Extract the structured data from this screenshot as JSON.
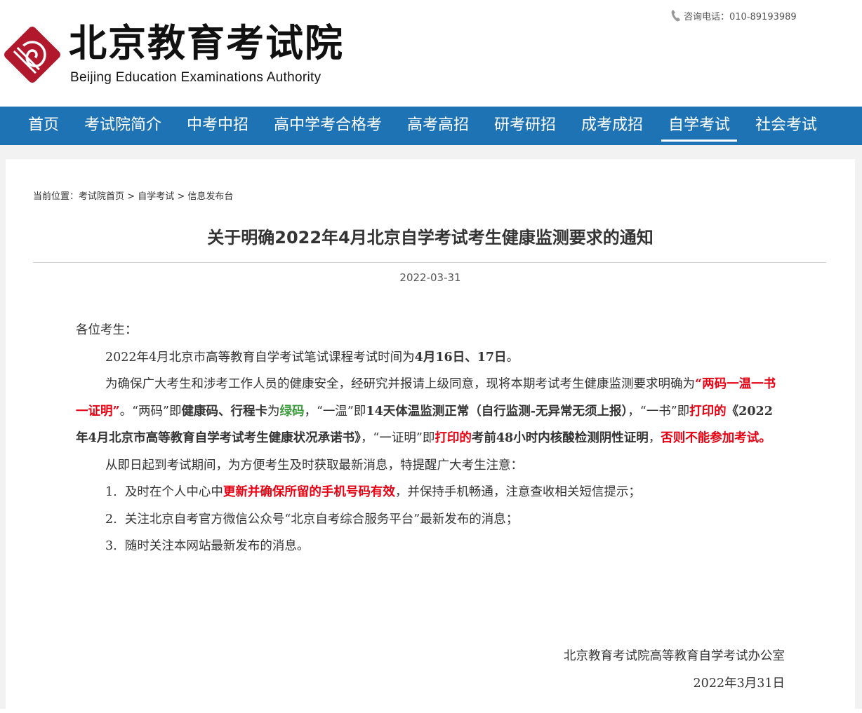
{
  "header": {
    "title_cn": "北京教育考试院",
    "title_en": "Beijing Education Examinations Authority",
    "hotline": "咨询电话：010-89193989",
    "brand_color": "#b2182b"
  },
  "nav": {
    "items": [
      {
        "label": "首页"
      },
      {
        "label": "考试院简介"
      },
      {
        "label": "中考中招"
      },
      {
        "label": "高中学考合格考"
      },
      {
        "label": "高考高招"
      },
      {
        "label": "研考研招"
      },
      {
        "label": "成考成招"
      },
      {
        "label": "自学考试"
      },
      {
        "label": "社会考试"
      }
    ],
    "active": "自学考试",
    "bg_color": "#1e73b4"
  },
  "breadcrumb": {
    "prefix": "当前位置：",
    "items": [
      "考试院首页",
      "自学考试",
      "信息发布台"
    ],
    "sep": " > "
  },
  "article": {
    "title": "关于明确2022年4月北京自学考试考生健康监测要求的通知",
    "date": "2022-03-31",
    "greeting": "各位考生：",
    "p1": {
      "t1": "2022年4月北京市高等教育自学考试笔试课程考试时间为",
      "b1": "4月16日、17日",
      "t2": "。"
    },
    "p2": {
      "t1": "为确保广大考生和涉考工作人员的健康安全，经研究并报请上级同意，现将本期考试考生健康监测要求明确为",
      "r1": "“两码一温一书一证明”",
      "t2": "。“两码”即",
      "b1": "健康码、行程卡",
      "t3": "为",
      "g1": "绿码",
      "t4": "，“一温”即",
      "b2": "14天体温监测正常（自行监测-无异常无须上报）",
      "t5": "，“一书”即",
      "r2": "打印的",
      "b3": "《2022年4月北京市高等教育自学考试考生健康状况承诺书》",
      "t6": "，“一证明”即",
      "r3": "打印的",
      "b4": "考前48小时内核酸检测阴性证明",
      "t7": "，",
      "r4": "否则不能参加考试。"
    },
    "p3": "从即日起到考试期间，为方便考生及时获取最新消息，特提醒广大考生注意：",
    "li1": {
      "n": "1.",
      "t1": "及时在个人中心中",
      "r1": "更新并确保所留的手机号码有效",
      "t2": "，并保持手机畅通，注意查收相关短信提示；"
    },
    "li2": {
      "n": "2.",
      "t1": "关注北京自考官方微信公众号“北京自考综合服务平台”最新发布的消息；"
    },
    "li3": {
      "n": "3.",
      "t1": "随时关注本网站最新发布的消息。"
    },
    "sign_org": "北京教育考试院高等教育自学考试办公室",
    "sign_date": "2022年3月31日"
  }
}
